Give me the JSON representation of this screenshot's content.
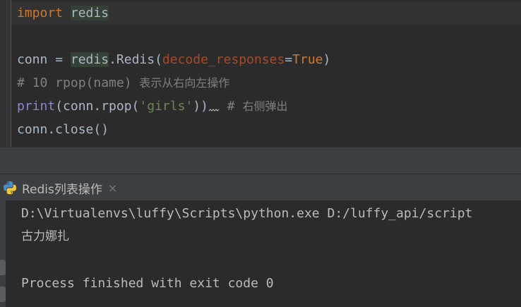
{
  "editor": {
    "line1": {
      "keyword": "import",
      "module": "redis"
    },
    "line3": {
      "var": "conn",
      "eq": " = ",
      "module": "redis",
      "dot_class": ".Redis(",
      "param": "decode_responses",
      "assign": "=",
      "value": "True",
      "close": ")"
    },
    "line4": {
      "comment_code": "# 10 rpop(name) ",
      "comment_cjk": "表示从右向左操作"
    },
    "line5": {
      "builtin": "print",
      "open": "(conn.rpop(",
      "string": "'girls'",
      "close": "))",
      "comment_hash": " # ",
      "comment_cjk": "右侧弹出"
    },
    "line6": {
      "code": "conn.close()"
    }
  },
  "run_tab": {
    "label": "Redis列表操作",
    "close": "×"
  },
  "console": {
    "lines": [
      "D:\\Virtualenvs\\luffy\\Scripts\\python.exe D:/luffy_api/script",
      "古力娜扎",
      "",
      "Process finished with exit code 0"
    ]
  },
  "colors": {
    "background": "#2b2b2b",
    "keyword": "#cc7832",
    "string": "#6a8759",
    "comment": "#808080",
    "builtin": "#8888c6",
    "parameter": "#aa4926"
  }
}
